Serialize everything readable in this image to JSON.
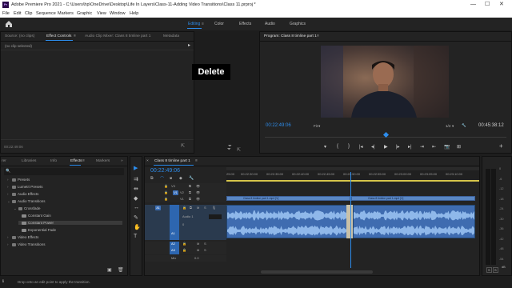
{
  "titlebar": {
    "app_icon": "Pr",
    "title": "Adobe Premiere Pro 2021 - C:\\Users\\hp\\OneDrive\\Desktop\\Life In Layers\\Class-11-Adding Video Transitions\\Class 11.prproj *",
    "minimize": "—",
    "maximize": "☐",
    "close": "✕"
  },
  "menu": [
    "File",
    "Edit",
    "Clip",
    "Sequence",
    "Markers",
    "Graphic",
    "View",
    "Window",
    "Help"
  ],
  "workspaces": {
    "items": [
      "Editing",
      "Color",
      "Effects",
      "Audio",
      "Graphics"
    ],
    "active": "Editing",
    "menu_icon": "≡"
  },
  "effect_controls": {
    "tabs": [
      "Source: (no clips)",
      "Effect Controls",
      "Audio Clip Mixer: Class 8 timline part 1",
      "Metadata"
    ],
    "active_tab": "Effect Controls",
    "tab_menu": "≡",
    "no_clip": "(no clip selected)",
    "expand_icon": "▸",
    "timecode": "00:22:49:06",
    "filter_icon": "⏷",
    "export_icon": "⇱"
  },
  "overlay": {
    "label": "Delete"
  },
  "program_monitor": {
    "tab": "Program: Class 8 timline part 1",
    "tab_menu": "≡",
    "timecode": "00:22:49:06",
    "fit": "Fit",
    "fit_arrow": "▾",
    "resolution": "1/4",
    "res_arrow": "▾",
    "duration": "00:45:38:12",
    "wrench_icon": "🔧",
    "buttons": [
      "▾",
      "{",
      "}",
      "|◂",
      "◂|",
      "▶",
      "|▸",
      "▸|",
      "⇥",
      "⇤",
      "📷",
      "⊞"
    ],
    "add_icon": "+"
  },
  "project_panel": {
    "tabs": [
      "Libraries",
      "Info",
      "Effects",
      "Markers"
    ],
    "partial_tab": "rer",
    "active_tab": "Effects",
    "overflow": "»",
    "search_icon": "🔍",
    "tree": [
      {
        "label": "Presets",
        "level": 0,
        "open": false
      },
      {
        "label": "Lumetri Presets",
        "level": 0,
        "open": false
      },
      {
        "label": "Audio Effects",
        "level": 0,
        "open": false
      },
      {
        "label": "Audio Transitions",
        "level": 0,
        "open": true
      },
      {
        "label": "Crossfade",
        "level": 1,
        "open": true
      },
      {
        "label": "Constant Gain",
        "level": 2,
        "open": false
      },
      {
        "label": "Constant Power",
        "level": 2,
        "open": false,
        "selected": true
      },
      {
        "label": "Exponential Fade",
        "level": 2,
        "open": false
      },
      {
        "label": "Video Effects",
        "level": 0,
        "open": false
      },
      {
        "label": "Video Transitions",
        "level": 0,
        "open": false
      }
    ],
    "new_bin_icon": "▣",
    "delete_icon": "🗑"
  },
  "tools": [
    "▶",
    "⇉",
    "⇹",
    "◆",
    "↔",
    "✎",
    "✋",
    "T"
  ],
  "timeline": {
    "tab": "Class 8 timline part 1",
    "close_tab": "×",
    "tab_menu": "≡",
    "timecode": "00:22:49:06",
    "ruler": [
      "25:00",
      "00:22:30:00",
      "00:22:35:00",
      "00:22:40:00",
      "00:22:45:00",
      "00:22:50:00",
      "00:22:55:00",
      "00:23:00:00",
      "00:23:05:00",
      "00:23:10:00"
    ],
    "tracks": {
      "v3": "V3",
      "v2": "V2",
      "v1": "V1",
      "a1": "A1",
      "a2": "A2",
      "a3": "A3",
      "src_v1": "V1",
      "src_a1": "A1",
      "audio1_name": "Audio 1",
      "audio_vol": "0",
      "mix": "Mix",
      "mix_val": "0.0"
    },
    "clips": {
      "video_left": "Class 8 timline part 1.mp4 [V]",
      "video_right": "Class 8 timline part 1.mp4 [V]"
    },
    "playhead_fraction": 0.49,
    "cut_fraction": 0.505,
    "toggles": [
      "⧉",
      "⌒",
      "⧈",
      "◆",
      "🔧"
    ]
  },
  "audio_meter": {
    "scale": [
      "0",
      "-6",
      "-12",
      "-18",
      "-24",
      "-30",
      "-36",
      "-42",
      "-48",
      "-54"
    ],
    "db": "dB",
    "solo": "S",
    "solo2": "S"
  },
  "status": "Drop onto an edit point to apply the transition."
}
